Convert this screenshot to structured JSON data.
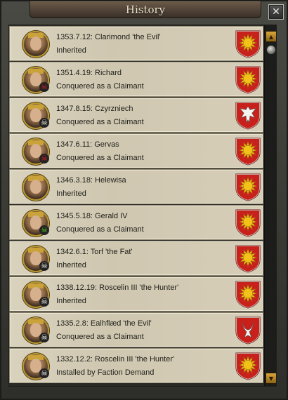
{
  "window": {
    "title": "History",
    "close_label": "✕"
  },
  "entries": [
    {
      "date_name": "1353.7.12: Clarimond 'the Evil'",
      "how": "Inherited",
      "badge": "",
      "coa": "sun-red"
    },
    {
      "date_name": "1351.4.19: Richard",
      "how": "Conquered as a Claimant",
      "badge": "skull-red",
      "coa": "sun-red"
    },
    {
      "date_name": "1347.8.15: Czyrzniech",
      "how": "Conquered as a Claimant",
      "badge": "skull-white",
      "coa": "eagle-white"
    },
    {
      "date_name": "1347.6.11: Gervas",
      "how": "Conquered as a Claimant",
      "badge": "skull-red",
      "coa": "sun-red"
    },
    {
      "date_name": "1346.3.18: Helewisa",
      "how": "Inherited",
      "badge": "",
      "coa": "sun-red"
    },
    {
      "date_name": "1345.5.18: Gerald IV",
      "how": "Conquered as a Claimant",
      "badge": "skull-green",
      "coa": "sun-red"
    },
    {
      "date_name": "1342.6.1: Torf 'the Fat'",
      "how": "Inherited",
      "badge": "skull-white",
      "coa": "sun-red"
    },
    {
      "date_name": "1338.12.19: Roscelin III 'the Hunter'",
      "how": "Inherited",
      "badge": "skull-white",
      "coa": "sun-red"
    },
    {
      "date_name": "1335.2.8: Ealhflæd 'the Evil'",
      "how": "Conquered as a Claimant",
      "badge": "skull-white",
      "coa": "horns-white"
    },
    {
      "date_name": "1332.12.2: Roscelin III 'the Hunter'",
      "how": "Installed by Faction Demand",
      "badge": "skull-white",
      "coa": "sun-red"
    }
  ],
  "colors": {
    "shield_red": "#c8211c",
    "sun_yellow": "#f2c21a",
    "row_bg": "#d4ccb5",
    "gold": "#b8952c"
  },
  "icons": {
    "close": "close-icon",
    "scroll_up": "chevron-up-icon",
    "scroll_down": "chevron-down-icon",
    "skull": "skull-icon"
  }
}
